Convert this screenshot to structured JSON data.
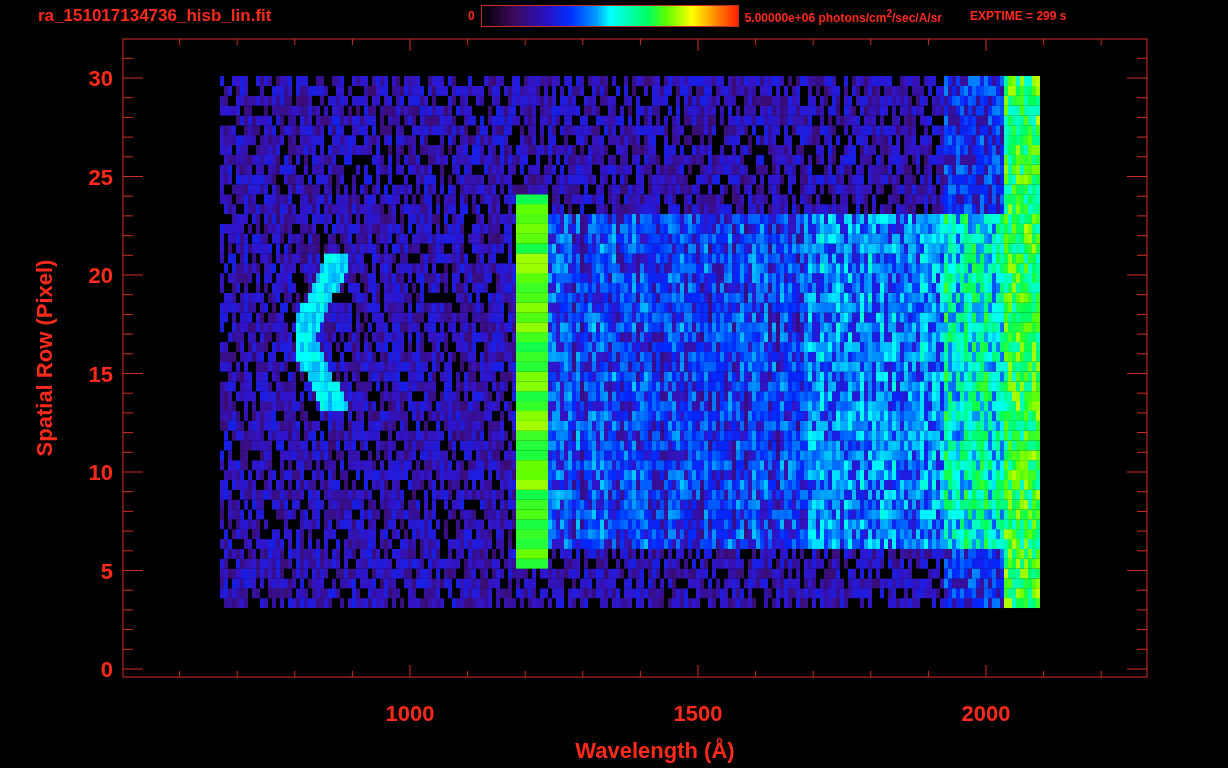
{
  "title": "ra_151017134736_hisb_lin.fit",
  "colorbar": {
    "min_label": "0",
    "max_label": "5.00000e+06 photons/cm$^{2}$/sec/A/sr"
  },
  "exptime": "EXPTIME = 299 s",
  "plot": {
    "ylabel": "Spatial Row (Pixel)",
    "xlabel": "Wavelength (Å)",
    "yticks": [
      "30",
      "25",
      "20",
      "15",
      "10",
      "5",
      "0"
    ],
    "xticks": [
      "1000",
      "1500",
      "2000"
    ]
  }
}
